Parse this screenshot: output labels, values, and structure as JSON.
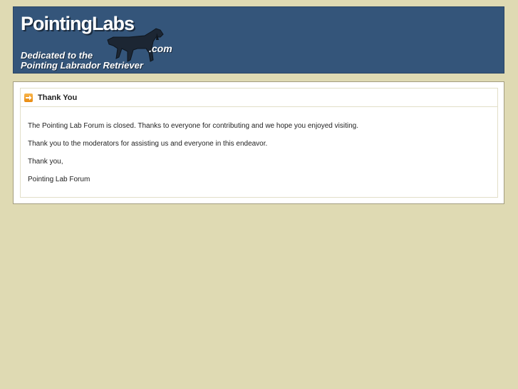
{
  "header": {
    "logo_main": "PointingLabs",
    "logo_com": ".com",
    "tagline_line1": "Dedicated to the",
    "tagline_line2": "Pointing Labrador Retriever"
  },
  "panel": {
    "title": "Thank You",
    "paragraphs": [
      "The Pointing Lab Forum is closed. Thanks to everyone for contributing and we hope you enjoyed visiting.",
      "Thank you to the moderators for assisting us and everyone in this endeavor.",
      "Thank you,",
      "Pointing Lab Forum"
    ]
  },
  "colors": {
    "page_background": "#dfdab3",
    "header_background": "#34557a",
    "arrow_accent": "#f0a02a"
  }
}
